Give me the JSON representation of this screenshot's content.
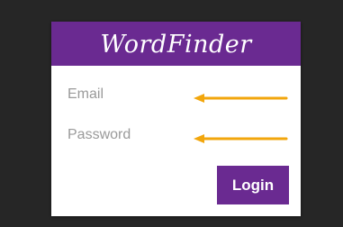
{
  "app": {
    "brand": "WordFinder"
  },
  "form": {
    "email_placeholder": "Email",
    "password_placeholder": "Password",
    "login_label": "Login"
  },
  "colors": {
    "background": "#262626",
    "brand_purple": "#6a2a91",
    "card": "#ffffff",
    "arrow": "#f2a60c"
  },
  "annotations": {
    "arrows": [
      "arrow-left-icon",
      "arrow-left-icon"
    ]
  }
}
